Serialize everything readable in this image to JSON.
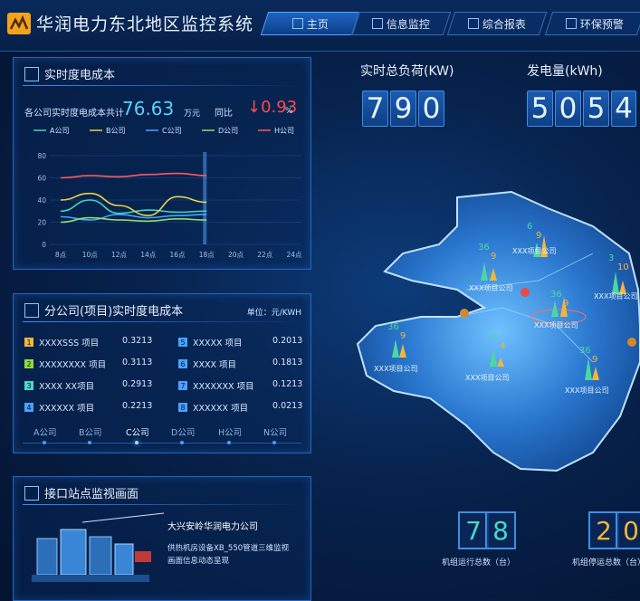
{
  "app": {
    "title": "华润电力东北地区监控系统"
  },
  "nav": [
    {
      "label": "主页",
      "icon": "home-icon",
      "active": true
    },
    {
      "label": "信息监控",
      "icon": "monitor-icon",
      "active": false
    },
    {
      "label": "综合报表",
      "icon": "report-icon",
      "active": false
    },
    {
      "label": "环保预警",
      "icon": "warning-icon",
      "active": false
    }
  ],
  "realtime_cost": {
    "title": "实时度电成本",
    "total_label": "各公司实时度电成本共计",
    "total_value": "76.63",
    "total_unit": "万元",
    "yoy_label": "同比",
    "yoy_arrow": "↓",
    "yoy_value": "0.93",
    "yoy_unit": "%"
  },
  "chart_data": {
    "type": "line",
    "x": [
      "8点",
      "10点",
      "12点",
      "14点",
      "16点",
      "18点",
      "20点",
      "22点",
      "24点"
    ],
    "ylim": [
      0,
      80
    ],
    "yticks": [
      "0",
      "10",
      "20",
      "30",
      "40",
      "50",
      "60",
      "70",
      "80"
    ],
    "series": [
      {
        "name": "A公司",
        "color": "#3fd6c2",
        "values": [
          30,
          40,
          28,
          31,
          29,
          30
        ]
      },
      {
        "name": "B公司",
        "color": "#e6d34a",
        "values": [
          40,
          46,
          35,
          26,
          43,
          38
        ]
      },
      {
        "name": "C公司",
        "color": "#4aa3ff",
        "values": [
          25,
          22,
          27,
          24,
          26,
          27
        ]
      },
      {
        "name": "D公司",
        "color": "#8fdc6a",
        "values": [
          20,
          24,
          22,
          21,
          23,
          22
        ]
      },
      {
        "name": "H公司",
        "color": "#ff5a5a",
        "values": [
          60,
          62,
          61,
          63,
          64,
          62
        ]
      }
    ]
  },
  "branch_cost": {
    "title": "分公司(项目)实时度电成本",
    "unit": "单位：元/KWH",
    "rows": [
      {
        "num": "1",
        "color": "#f2b63a",
        "name": "XXXXSSS 项目",
        "value": "0.3213"
      },
      {
        "num": "2",
        "color": "#8fdc3a",
        "name": "XXXXXXXX 项目",
        "value": "0.3113"
      },
      {
        "num": "3",
        "color": "#4ad8c8",
        "name": "XXXX XX项目",
        "value": "0.2913"
      },
      {
        "num": "4",
        "color": "#4aa3ff",
        "name": "XXXXXX 项目",
        "value": "0.2213"
      },
      {
        "num": "5",
        "color": "#4aa3ff",
        "name": "XXXXX 项目",
        "value": "0.2013"
      },
      {
        "num": "6",
        "color": "#4aa3ff",
        "name": "XXXX 项目",
        "value": "0.1813"
      },
      {
        "num": "7",
        "color": "#4aa3ff",
        "name": "XXXXXXX 项目",
        "value": "0.1213"
      },
      {
        "num": "8",
        "color": "#4aa3ff",
        "name": "XXXXXX 项目",
        "value": "0.0213"
      }
    ],
    "tabs": [
      "A公司",
      "B公司",
      "C公司",
      "D公司",
      "H公司",
      "N公司"
    ],
    "selected_tab": "C公司"
  },
  "station": {
    "title": "接口站点监视画面",
    "name": "大兴安岭华润电力公司",
    "desc_line1": "供热机房设备XB_550管道三维监视",
    "desc_line2": "画面信息动态呈现"
  },
  "load": {
    "label": "实时总负荷(KW)",
    "digits": [
      "7",
      "9",
      "0"
    ]
  },
  "generation": {
    "label": "发电量(kWh)",
    "digits": [
      "5",
      "0",
      "5",
      "4"
    ]
  },
  "running": {
    "digits": [
      "7",
      "8"
    ],
    "label": "机组运行总数（台）",
    "color": "#4ad8c8"
  },
  "stopped": {
    "digits": [
      "2",
      "0"
    ],
    "label": "机组停运总数（台）",
    "color": "#f2b63a"
  },
  "map": {
    "sites": [
      {
        "label": "XXX项目公司",
        "n1": "6",
        "n2": "9"
      },
      {
        "label": "XXX项目公司",
        "n1": "36",
        "n2": "9"
      },
      {
        "label": "XXX项目公司",
        "n1": "36",
        "n2": "9"
      },
      {
        "label": "XXX项目公司",
        "n1": "3",
        "n2": "10"
      },
      {
        "label": "XXX项目公司",
        "n1": "36",
        "n2": "9"
      },
      {
        "label": "XXX项目公司",
        "n1": "40",
        "n2": "4"
      },
      {
        "label": "XXX项目公司",
        "n1": "36",
        "n2": "9"
      }
    ]
  }
}
